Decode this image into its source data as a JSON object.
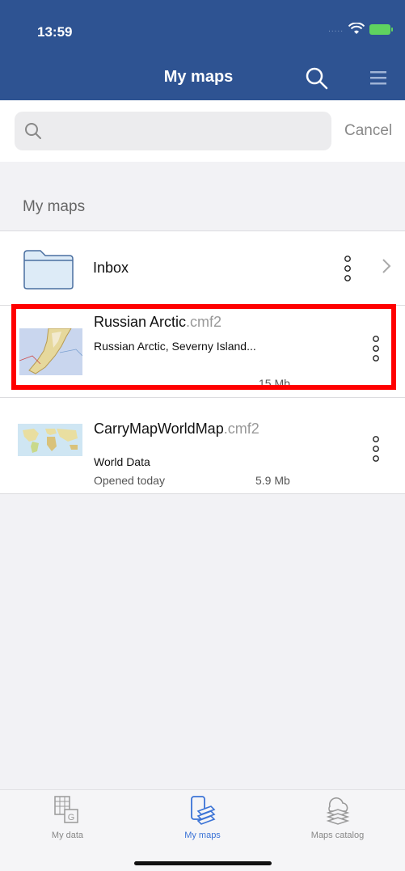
{
  "status_bar": {
    "time": "13:59",
    "signal": "....."
  },
  "header": {
    "title": "My maps",
    "search_icon": "search-icon",
    "menu_icon": "hamburger-menu-icon"
  },
  "search": {
    "value": "",
    "placeholder": "",
    "cancel_label": "Cancel"
  },
  "section": {
    "title": "My maps"
  },
  "items": {
    "inbox": {
      "label": "Inbox"
    },
    "russian_arctic": {
      "name": "Russian Arctic",
      "ext": ".cmf2",
      "description": "Russian Arctic, Severny Island...",
      "size": "15 Mb"
    },
    "world_map": {
      "name": "CarryMapWorldMap",
      "ext": ".cmf2",
      "description": "World Data",
      "opened": "Opened today",
      "size": "5.9 Mb"
    }
  },
  "tabs": {
    "my_data": "My data",
    "my_maps": "My maps",
    "catalog": "Maps catalog"
  },
  "colors": {
    "header": "#2e5392",
    "highlight": "#ff0000",
    "active_tab": "#3b73d6"
  }
}
